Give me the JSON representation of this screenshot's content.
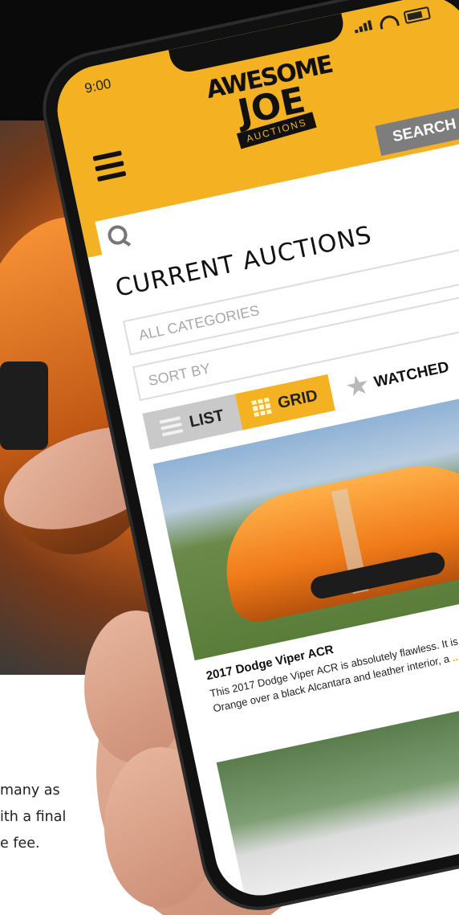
{
  "status": {
    "time": "9:00"
  },
  "header": {
    "logo": {
      "line1": "AWESOME",
      "line2": "JOE",
      "line3": "AUCTIONS"
    },
    "search_button": "SEARCH",
    "search_placeholder": ""
  },
  "main": {
    "title": "CURRENT AUCTIONS",
    "category_select": "ALL CATEGORIES",
    "sort_select": "SORT BY",
    "view_list": "LIST",
    "view_grid": "GRID",
    "watched": "WATCHED"
  },
  "listings": [
    {
      "title": "2017 Dodge Viper ACR",
      "description": "This 2017 Dodge Viper ACR is absolutely flawless. It is finished in Header Orange over a black Alcantara and leather interior, a",
      "more": "..."
    }
  ],
  "marketing": {
    "lines": [
      "many as",
      "ith a final",
      "e fee."
    ]
  },
  "colors": {
    "accent": "#f4b223",
    "button_gray": "#7d7d7d",
    "list_gray": "#c9c9c9"
  }
}
